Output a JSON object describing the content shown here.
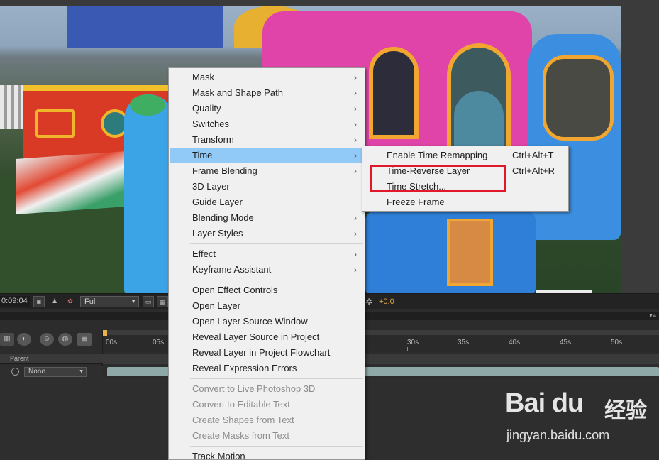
{
  "viewer": {
    "timecode": "0:09:04",
    "resolution": "Full",
    "exposure": "+0.0",
    "icons": [
      "snapshot-icon",
      "show-snapshot-icon",
      "color-channels-icon",
      "region-of-interest-icon",
      "transparency-grid-icon",
      "reset-exposure-icon"
    ]
  },
  "timeline": {
    "ruler_ticks": [
      "00s",
      "05s",
      "30s",
      "35s",
      "40s",
      "45s",
      "50s"
    ],
    "column_header": "Parent",
    "parent_value": "None"
  },
  "context_menu": {
    "items": [
      {
        "label": "Mask",
        "submenu": true
      },
      {
        "label": "Mask and Shape Path",
        "submenu": true
      },
      {
        "label": "Quality",
        "submenu": true
      },
      {
        "label": "Switches",
        "submenu": true
      },
      {
        "label": "Transform",
        "submenu": true
      },
      {
        "label": "Time",
        "submenu": true,
        "highlighted": true
      },
      {
        "label": "Frame Blending",
        "submenu": true
      },
      {
        "label": "3D Layer"
      },
      {
        "label": "Guide Layer"
      },
      {
        "label": "Blending Mode",
        "submenu": true
      },
      {
        "label": "Layer Styles",
        "submenu": true
      },
      {
        "label": "Effect",
        "submenu": true
      },
      {
        "label": "Keyframe Assistant",
        "submenu": true
      },
      {
        "label": "Open Effect Controls"
      },
      {
        "label": "Open Layer"
      },
      {
        "label": "Open Layer Source Window"
      },
      {
        "label": "Reveal Layer Source in Project"
      },
      {
        "label": "Reveal Layer in Project Flowchart"
      },
      {
        "label": "Reveal Expression Errors"
      },
      {
        "label": "Convert to Live Photoshop 3D",
        "disabled": true
      },
      {
        "label": "Convert to Editable Text",
        "disabled": true
      },
      {
        "label": "Create Shapes from Text",
        "disabled": true
      },
      {
        "label": "Create Masks from Text",
        "disabled": true
      },
      {
        "label": "Track Motion"
      }
    ],
    "submenu_arrow": "›"
  },
  "time_submenu": {
    "items": [
      {
        "label": "Enable Time Remapping",
        "shortcut": "Ctrl+Alt+T"
      },
      {
        "label": "Time-Reverse Layer",
        "shortcut": "Ctrl+Alt+R"
      },
      {
        "label": "Time Stretch..."
      },
      {
        "label": "Freeze Frame"
      }
    ]
  },
  "watermark": {
    "logo": "Bai du",
    "cn": "经验",
    "url": "jingyan.baidu.com"
  },
  "colors": {
    "menu_bg": "#f0f0f0",
    "highlight": "#91c9f7",
    "annotation": "#e0182a"
  }
}
